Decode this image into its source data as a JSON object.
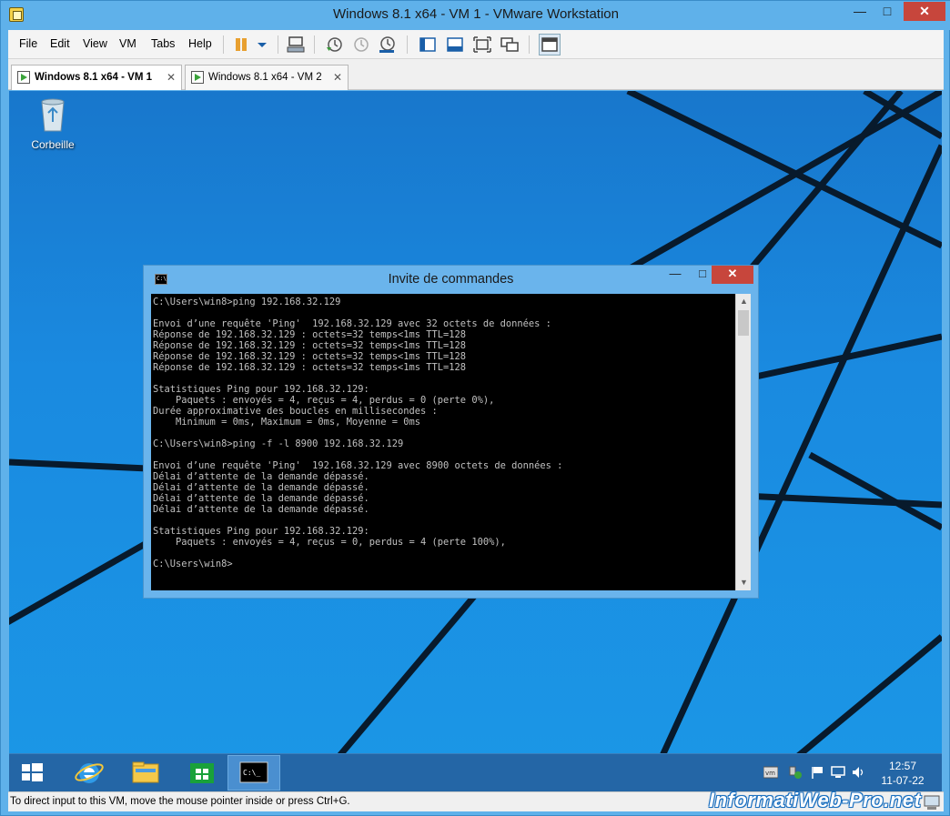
{
  "window": {
    "title": "Windows 8.1 x64 - VM 1 - VMware Workstation",
    "minimize_label": "—",
    "maximize_label": "□",
    "close_label": "✕"
  },
  "menu": {
    "items": [
      "File",
      "Edit",
      "View",
      "VM",
      "Tabs",
      "Help"
    ]
  },
  "toolbar": {
    "icons": [
      "pause-icon",
      "send-ctrl-alt-del-icon",
      "snapshot-take-icon",
      "snapshot-revert-icon",
      "snapshot-manager-icon",
      "show-library-icon",
      "thumbnail-bar-icon",
      "full-screen-icon",
      "unity-icon",
      "console-view-icon"
    ],
    "pause_color": "#e8a030"
  },
  "tabs": [
    {
      "label": "Windows 8.1 x64 - VM 1",
      "active": true
    },
    {
      "label": "Windows 8.1 x64 - VM 2",
      "active": false
    }
  ],
  "desktop": {
    "recycle_bin_label": "Corbeille",
    "background_color": "#1a8ae0"
  },
  "console": {
    "title": "Invite de commandes",
    "icon_text": "C:\\",
    "lines": [
      "C:\\Users\\win8>ping 192.168.32.129",
      "",
      "Envoi d’une requête 'Ping'  192.168.32.129 avec 32 octets de données :",
      "Réponse de 192.168.32.129 : octets=32 temps<1ms TTL=128",
      "Réponse de 192.168.32.129 : octets=32 temps<1ms TTL=128",
      "Réponse de 192.168.32.129 : octets=32 temps<1ms TTL=128",
      "Réponse de 192.168.32.129 : octets=32 temps<1ms TTL=128",
      "",
      "Statistiques Ping pour 192.168.32.129:",
      "    Paquets : envoyés = 4, reçus = 4, perdus = 0 (perte 0%),",
      "Durée approximative des boucles en millisecondes :",
      "    Minimum = 0ms, Maximum = 0ms, Moyenne = 0ms",
      "",
      "C:\\Users\\win8>ping -f -l 8900 192.168.32.129",
      "",
      "Envoi d’une requête 'Ping'  192.168.32.129 avec 8900 octets de données :",
      "Délai d’attente de la demande dépassé.",
      "Délai d’attente de la demande dépassé.",
      "Délai d’attente de la demande dépassé.",
      "Délai d’attente de la demande dépassé.",
      "",
      "Statistiques Ping pour 192.168.32.129:",
      "    Paquets : envoyés = 4, reçus = 0, perdus = 4 (perte 100%),",
      "",
      "C:\\Users\\win8>"
    ]
  },
  "taskbar": {
    "items": [
      "start-icon",
      "internet-explorer-icon",
      "file-explorer-icon",
      "store-icon",
      "command-prompt-icon"
    ],
    "cmd_icon_text": "C:\\_",
    "tray_icons": [
      "vmware-tools-icon",
      "safely-remove-hardware-icon",
      "action-center-flag-icon",
      "network-icon",
      "volume-icon"
    ],
    "clock_time": "12:57",
    "clock_date": "11-07-22"
  },
  "status": {
    "text": "To direct input to this VM, move the mouse pointer inside or press Ctrl+G.",
    "watermark": "InformatiWeb-Pro.net"
  }
}
